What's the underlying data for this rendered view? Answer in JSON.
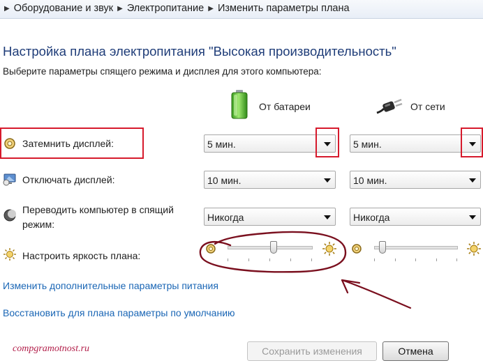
{
  "breadcrumb": {
    "items": [
      "Оборудование и звук",
      "Электропитание",
      "Изменить параметры плана"
    ]
  },
  "header": {
    "title": "Настройка плана электропитания \"Высокая производительность\"",
    "subtitle": "Выберите параметры спящего режима и дисплея для этого компьютера:"
  },
  "columns": {
    "battery": "От батареи",
    "ac": "От сети"
  },
  "settings": [
    {
      "label": "Затемнить дисплей:",
      "battery": "5 мин.",
      "ac": "5 мин."
    },
    {
      "label": "Отключать дисплей:",
      "battery": "10 мин.",
      "ac": "10 мин."
    },
    {
      "label_line1": "Переводить компьютер в спящий",
      "label_line2": "режим:",
      "battery": "Никогда",
      "ac": "Никогда"
    }
  ],
  "brightness": {
    "label": "Настроить яркость плана:",
    "battery_level": 0.55,
    "ac_level": 0.1
  },
  "links": {
    "advanced": "Изменить дополнительные параметры питания",
    "restore": "Восстановить для плана параметры по умолчанию"
  },
  "watermark": "compgramotnost.ru",
  "buttons": {
    "save": "Сохранить изменения",
    "cancel": "Отмена"
  },
  "colors": {
    "title": "#1e3c78",
    "link": "#1a66b5",
    "annotation": "#d61a2c",
    "drawing": "#7a0f1e"
  }
}
